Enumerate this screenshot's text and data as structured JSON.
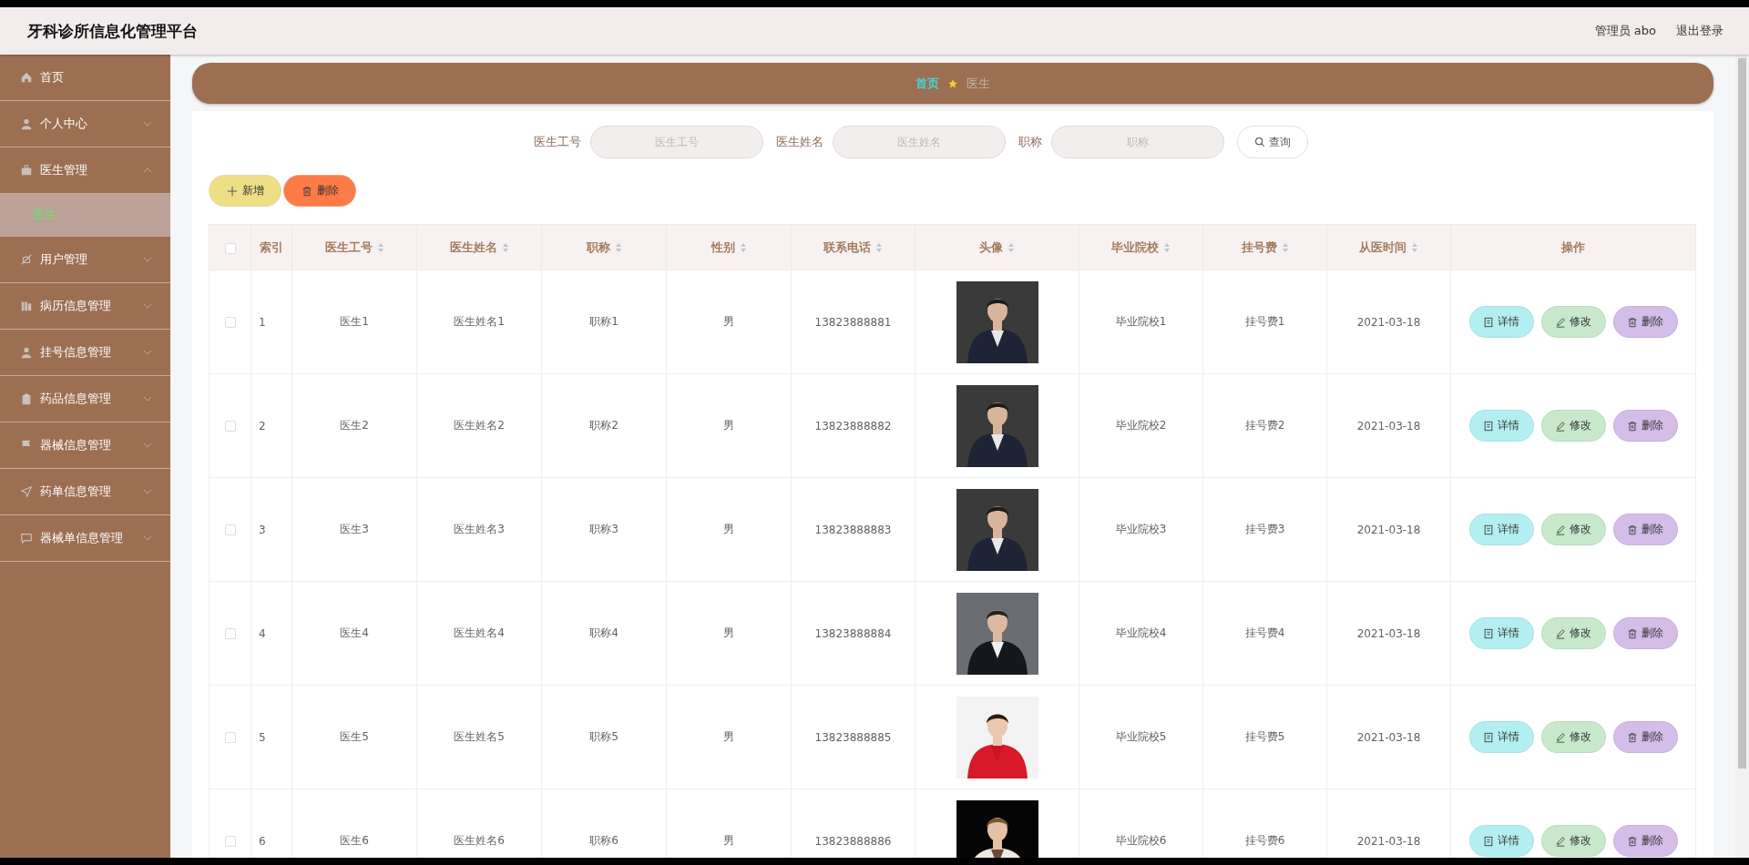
{
  "header": {
    "title": "牙科诊所信息化管理平台",
    "user": "管理员 abo",
    "logout": "退出登录"
  },
  "sidebar": {
    "items": [
      {
        "label": "首页",
        "kind": "link"
      },
      {
        "label": "个人中心",
        "kind": "group",
        "expanded": false
      },
      {
        "label": "医生管理",
        "kind": "group",
        "expanded": true,
        "children": [
          {
            "label": "医生",
            "selected": true
          }
        ]
      },
      {
        "label": "用户管理",
        "kind": "group",
        "expanded": false
      },
      {
        "label": "病历信息管理",
        "kind": "group",
        "expanded": false
      },
      {
        "label": "挂号信息管理",
        "kind": "group",
        "expanded": false
      },
      {
        "label": "药品信息管理",
        "kind": "group",
        "expanded": false
      },
      {
        "label": "器械信息管理",
        "kind": "group",
        "expanded": false
      },
      {
        "label": "药单信息管理",
        "kind": "group",
        "expanded": false
      },
      {
        "label": "器械单信息管理",
        "kind": "group",
        "expanded": false
      }
    ]
  },
  "breadcrumb": {
    "home": "首页",
    "current": "医生"
  },
  "search": {
    "fields": [
      {
        "label": "医生工号",
        "placeholder": "医生工号"
      },
      {
        "label": "医生姓名",
        "placeholder": "医生姓名"
      },
      {
        "label": "职称",
        "placeholder": "职称"
      }
    ],
    "button": "查询"
  },
  "toolbar": {
    "add": "新增",
    "delete": "删除"
  },
  "table": {
    "select_all_checked": false,
    "columns": [
      "索引",
      "医生工号",
      "医生姓名",
      "职称",
      "性别",
      "联系电话",
      "头像",
      "毕业院校",
      "挂号费",
      "从医时间",
      "操作"
    ],
    "rows": [
      {
        "checked": false,
        "cells": [
          "1",
          "医生1",
          "医生姓名1",
          "职称1",
          "男",
          "13823888881",
          "",
          "毕业院校1",
          "挂号费1",
          "2021-03-18"
        ],
        "photo": {
          "kind": "picture"
        },
        "actions": [
          "详情",
          "修改",
          "删除"
        ]
      },
      {
        "checked": false,
        "cells": [
          "2",
          "医生2",
          "医生姓名2",
          "职称2",
          "男",
          "13823888882",
          "",
          "毕业院校2",
          "挂号费2",
          "2021-03-18"
        ],
        "photo": {
          "kind": "picture"
        },
        "actions": [
          "详情",
          "修改",
          "删除"
        ]
      },
      {
        "checked": false,
        "cells": [
          "3",
          "医生3",
          "医生姓名3",
          "职称3",
          "男",
          "13823888883",
          "",
          "毕业院校3",
          "挂号费3",
          "2021-03-18"
        ],
        "photo": {
          "kind": "picture"
        },
        "actions": [
          "详情",
          "修改",
          "删除"
        ]
      },
      {
        "checked": false,
        "cells": [
          "4",
          "医生4",
          "医生姓名4",
          "职称4",
          "男",
          "13823888884",
          "",
          "毕业院校4",
          "挂号费4",
          "2021-03-18"
        ],
        "photo": {
          "kind": "picture"
        },
        "actions": [
          "详情",
          "修改",
          "删除"
        ]
      },
      {
        "checked": false,
        "cells": [
          "5",
          "医生5",
          "医生姓名5",
          "职称5",
          "男",
          "13823888885",
          "",
          "毕业院校5",
          "挂号费5",
          "2021-03-18"
        ],
        "photo": {
          "kind": "picture"
        },
        "actions": [
          "详情",
          "修改",
          "删除"
        ]
      },
      {
        "checked": false,
        "cells": [
          "6",
          "医生6",
          "医生姓名6",
          "职称6",
          "男",
          "13823888886",
          "",
          "毕业院校6",
          "挂号费6",
          "2021-03-18"
        ],
        "photo": {
          "kind": "picture"
        },
        "actions": [
          "详情",
          "修改",
          "删除"
        ]
      }
    ]
  }
}
